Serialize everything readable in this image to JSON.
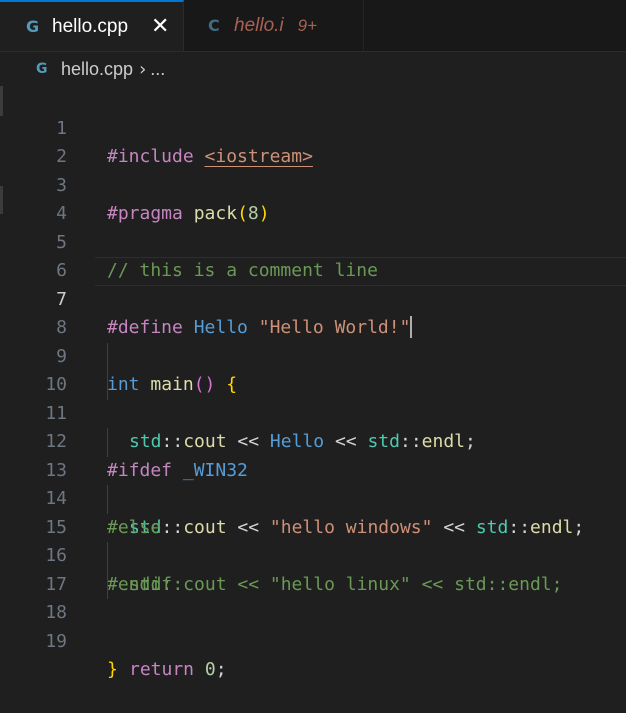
{
  "tabs": [
    {
      "icon": "cpp-file-icon",
      "label": "hello.cpp",
      "close": "✕",
      "active": true
    },
    {
      "icon": "c-file-icon",
      "label": "hello.i",
      "badge": "9+",
      "active": false
    }
  ],
  "breadcrumb": {
    "file": "hello.cpp",
    "separator": "›",
    "more": "..."
  },
  "editor": {
    "current_line": 7,
    "line_numbers": [
      "1",
      "2",
      "3",
      "4",
      "5",
      "6",
      "7",
      "8",
      "9",
      "10",
      "11",
      "12",
      "13",
      "14",
      "15",
      "16",
      "17",
      "18",
      "19"
    ],
    "tokens": {
      "l1_a": "#include ",
      "l1_b": "<iostream>",
      "l3_a": "#pragma ",
      "l3_b": "pack",
      "l3_c": "(",
      "l3_d": "8",
      "l3_e": ")",
      "l5": "// this is a comment line",
      "l7_a": "#define ",
      "l7_b": "Hello",
      "l7_c": " \"Hello World!\"",
      "l9_a": "int ",
      "l9_b": "main",
      "l9_c": "()",
      "l9_d": " {",
      "l10_a": "std",
      "l10_b": "::",
      "l10_c": "cout",
      "l10_d": " << ",
      "l10_e": "Hello",
      "l10_f": " << ",
      "l10_g": "std",
      "l10_h": "::",
      "l10_i": "endl",
      "l10_j": ";",
      "l12_a": "#ifdef ",
      "l12_b": "_WIN32",
      "l13_a": "std",
      "l13_b": "::",
      "l13_c": "cout",
      "l13_d": " << ",
      "l13_e": "\"hello windows\"",
      "l13_f": " << ",
      "l13_g": "std",
      "l13_h": "::",
      "l13_i": "endl",
      "l13_j": ";",
      "l14": "#else",
      "l15": "std::cout << \"hello linux\" << std::endl;",
      "l16": "#endif",
      "l18_a": "return ",
      "l18_b": "0",
      "l18_c": ";",
      "l19": "}"
    }
  },
  "colors": {
    "accent": "#0078d4",
    "background": "#1f1f1f",
    "tab_error": "#f48771"
  }
}
